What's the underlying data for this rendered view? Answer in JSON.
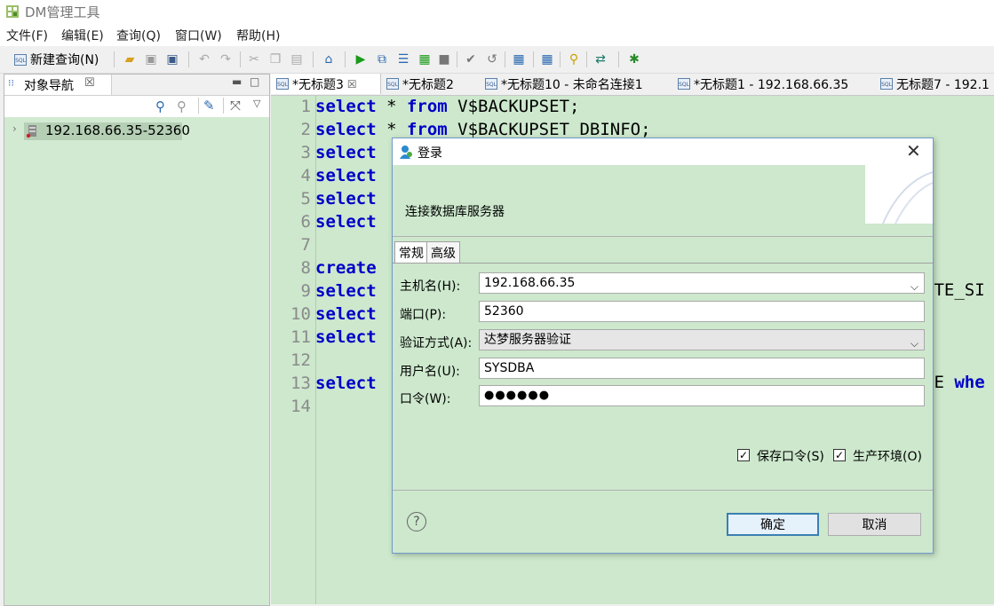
{
  "window": {
    "title": "DM管理工具"
  },
  "menu": [
    "文件(F)",
    "编辑(E)",
    "查询(Q)",
    "窗口(W)",
    "帮助(H)"
  ],
  "toolbar": {
    "new_query_label": "新建查询(N)"
  },
  "navigator": {
    "title": "对象导航",
    "tree": [
      {
        "label": "192.168.66.35-52360"
      }
    ]
  },
  "editor": {
    "tabs": [
      {
        "label": "*无标题3"
      },
      {
        "label": "*无标题2"
      },
      {
        "label": "*无标题10 - 未命名连接1"
      },
      {
        "label": "*无标题1 - 192.168.66.35"
      },
      {
        "label": "无标题7 - 192.1"
      }
    ],
    "lines": [
      {
        "n": "1",
        "kw": "select",
        "rest": " * from V$BACKUPSET;"
      },
      {
        "n": "2",
        "kw": "select",
        "rest": " * from V$BACKUPSET_DBINFO;"
      },
      {
        "n": "3",
        "kw": "select",
        "rest": ""
      },
      {
        "n": "4",
        "kw": "select",
        "rest": ""
      },
      {
        "n": "5",
        "kw": "select",
        "rest": ""
      },
      {
        "n": "6",
        "kw": "select",
        "rest": ""
      },
      {
        "n": "7",
        "kw": "",
        "rest": ""
      },
      {
        "n": "8",
        "kw": "create",
        "rest": ""
      },
      {
        "n": "9",
        "kw": "select",
        "rest": ""
      },
      {
        "n": "10",
        "kw": "select",
        "rest": ""
      },
      {
        "n": "11",
        "kw": "select",
        "rest": ""
      },
      {
        "n": "12",
        "kw": "",
        "rest": ""
      },
      {
        "n": "13",
        "kw": "select",
        "rest": ""
      },
      {
        "n": "14",
        "kw": "",
        "rest": ""
      }
    ],
    "overflow_fragments": {
      "line9": "ITE_SI",
      "line13_text": "LE ",
      "line13_kw": "whe"
    }
  },
  "dialog": {
    "title": "登录",
    "banner_text": "连接数据库服务器",
    "tabs": [
      "常规",
      "高级"
    ],
    "fields": {
      "host_label": "主机名(H):",
      "host_value": "192.168.66.35",
      "port_label": "端口(P):",
      "port_value": "52360",
      "auth_label": "验证方式(A):",
      "auth_value": "达梦服务器验证",
      "user_label": "用户名(U):",
      "user_value": "SYSDBA",
      "pwd_label": "口令(W):",
      "pwd_value": "●●●●●●"
    },
    "checkboxes": [
      {
        "label": "保存口令(S)",
        "checked": true
      },
      {
        "label": "生产环境(O)",
        "checked": true
      }
    ],
    "buttons": {
      "ok": "确定",
      "cancel": "取消"
    },
    "help_glyph": "?"
  },
  "colors": {
    "editor_bg": "#cde8cd",
    "keyword": "#0000c8",
    "dialog_border": "#6e9ac8"
  }
}
